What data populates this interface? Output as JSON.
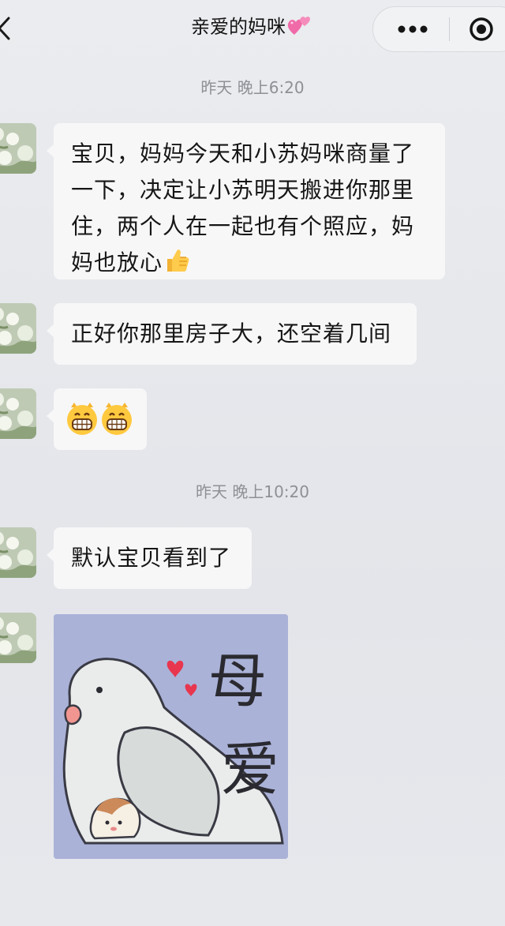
{
  "header": {
    "title": "亲爱的妈咪",
    "title_emoji": "two-hearts-emoji",
    "back_icon": "chevron-left-icon",
    "more_icon": "more-dots-icon",
    "record_icon": "record-circle-icon"
  },
  "conversation": {
    "time_1": "昨天 晚上6:20",
    "time_2": "昨天 晚上10:20",
    "messages": [
      {
        "text": "宝贝，妈妈今天和小苏妈咪商量了一下，决定让小苏明天搬进你那里住，两个人在一起也有个照应，妈妈也放心",
        "emoji": "thumbs-up-emoji"
      },
      {
        "text": "正好你那里房子大，还空着几间"
      },
      {
        "emoji": "grinning-face-emoji x2"
      },
      {
        "text": "默认宝贝看到了"
      },
      {
        "sticker": "pigeon-hugging-chick-sticker",
        "sticker_text": "母爱"
      }
    ]
  },
  "colors": {
    "background": "#e7e8ec",
    "bubble": "#f7f7f8",
    "timestamp": "#8e9096",
    "sticker_bg": "#aab2d8"
  }
}
